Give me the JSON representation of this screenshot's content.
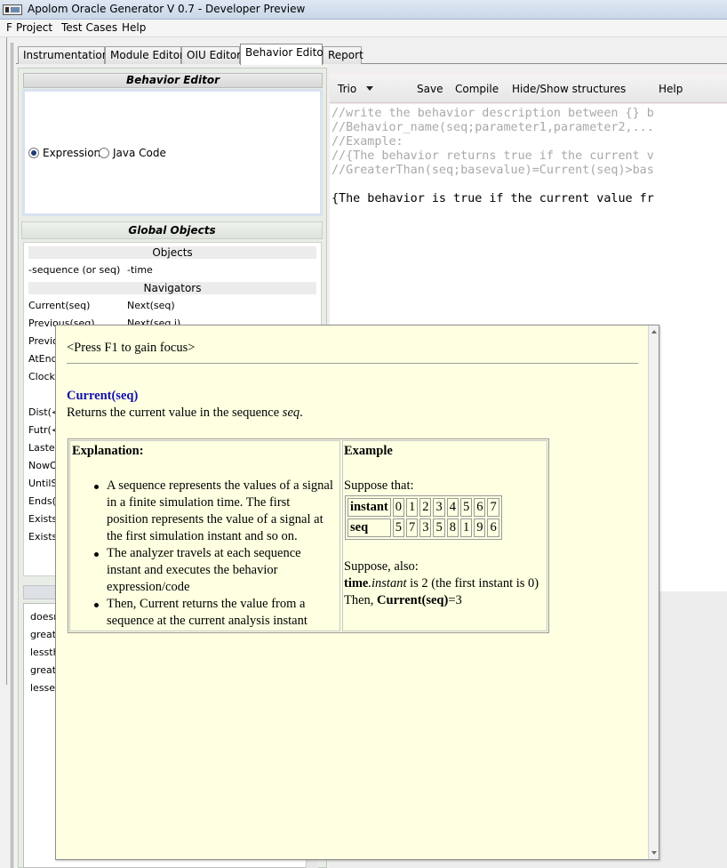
{
  "window": {
    "title": "Apolom Oracle Generator V 0.7 - Developer Preview"
  },
  "menu": [
    "Project",
    "Test Cases",
    "Help"
  ],
  "menu_cut": "F",
  "tabs": [
    "Instrumentation",
    "Module Editor",
    "OIU Editor",
    "Behavior Editor",
    "Report"
  ],
  "active_tab": "Behavior Editor",
  "behavior_editor": {
    "title": "Behavior Editor",
    "radio_expression": "Expression",
    "radio_java": "Java Code",
    "selected": "Expression"
  },
  "global_objects": {
    "title": "Global Objects",
    "objects_header": "Objects",
    "objects": [
      "-sequence (or seq)",
      "-time"
    ],
    "navigators_header": "Navigators",
    "nav_row1": [
      "Current(seq)",
      "Next(seq)"
    ],
    "nav_row2": [
      "Previous(seq)",
      "Next(seq,i)"
    ],
    "partial_items": [
      "Previo",
      "AtEnd",
      "Clock",
      "Dist(<",
      "Futr(<",
      "Lasted",
      "NowO",
      "UntilS",
      "Ends(",
      "Exists",
      "Exists"
    ]
  },
  "behaviors_list": [
    "doesn",
    "great",
    "lessth",
    "great",
    "lessed"
  ],
  "editor_toolbar": {
    "language": "Trio",
    "save": "Save",
    "compile": "Compile",
    "toggle": "Hide/Show structures",
    "help": "Help"
  },
  "editor_lines": {
    "c1": "//write the behavior description between {} b",
    "c2": "//Behavior_name(seq;parameter1,parameter2,...",
    "c3": "//Example:",
    "c4": "//{The behavior returns true if the current v",
    "c5": "//GreaterThan(seq;basevalue)=Current(seq)>bas",
    "code1": "{The behavior is true if the current value fr"
  },
  "help_popup": {
    "focus_hint": "<Press F1 to gain focus>",
    "function_name": "Current(seq)",
    "description_pre": "Returns the current value in the sequence ",
    "description_var": "seq",
    "description_post": ".",
    "explanation_header": "Explanation:",
    "bullets": [
      "A sequence represents the values of a signal in a finite simulation time. The first position represents the value of a signal at the first simulation instant and so on.",
      "The analyzer travels at each sequence instant and executes the behavior expression/code",
      "Then, Current returns the value from a sequence at the current analysis instant"
    ],
    "example_header": "Example",
    "suppose_that": "Suppose that:",
    "table": {
      "row1_label": "instant",
      "row1": [
        "0",
        "1",
        "2",
        "3",
        "4",
        "5",
        "6",
        "7"
      ],
      "row2_label": "seq",
      "row2": [
        "5",
        "7",
        "3",
        "5",
        "8",
        "1",
        "9",
        "6"
      ]
    },
    "suppose_also": "Suppose, also:",
    "time_bold": "time",
    "time_italic": ".instant",
    "time_rest": " is 2 (the first instant is 0)",
    "then_pre": "Then, ",
    "then_bold": "Current(seq)",
    "then_post": "=3"
  }
}
